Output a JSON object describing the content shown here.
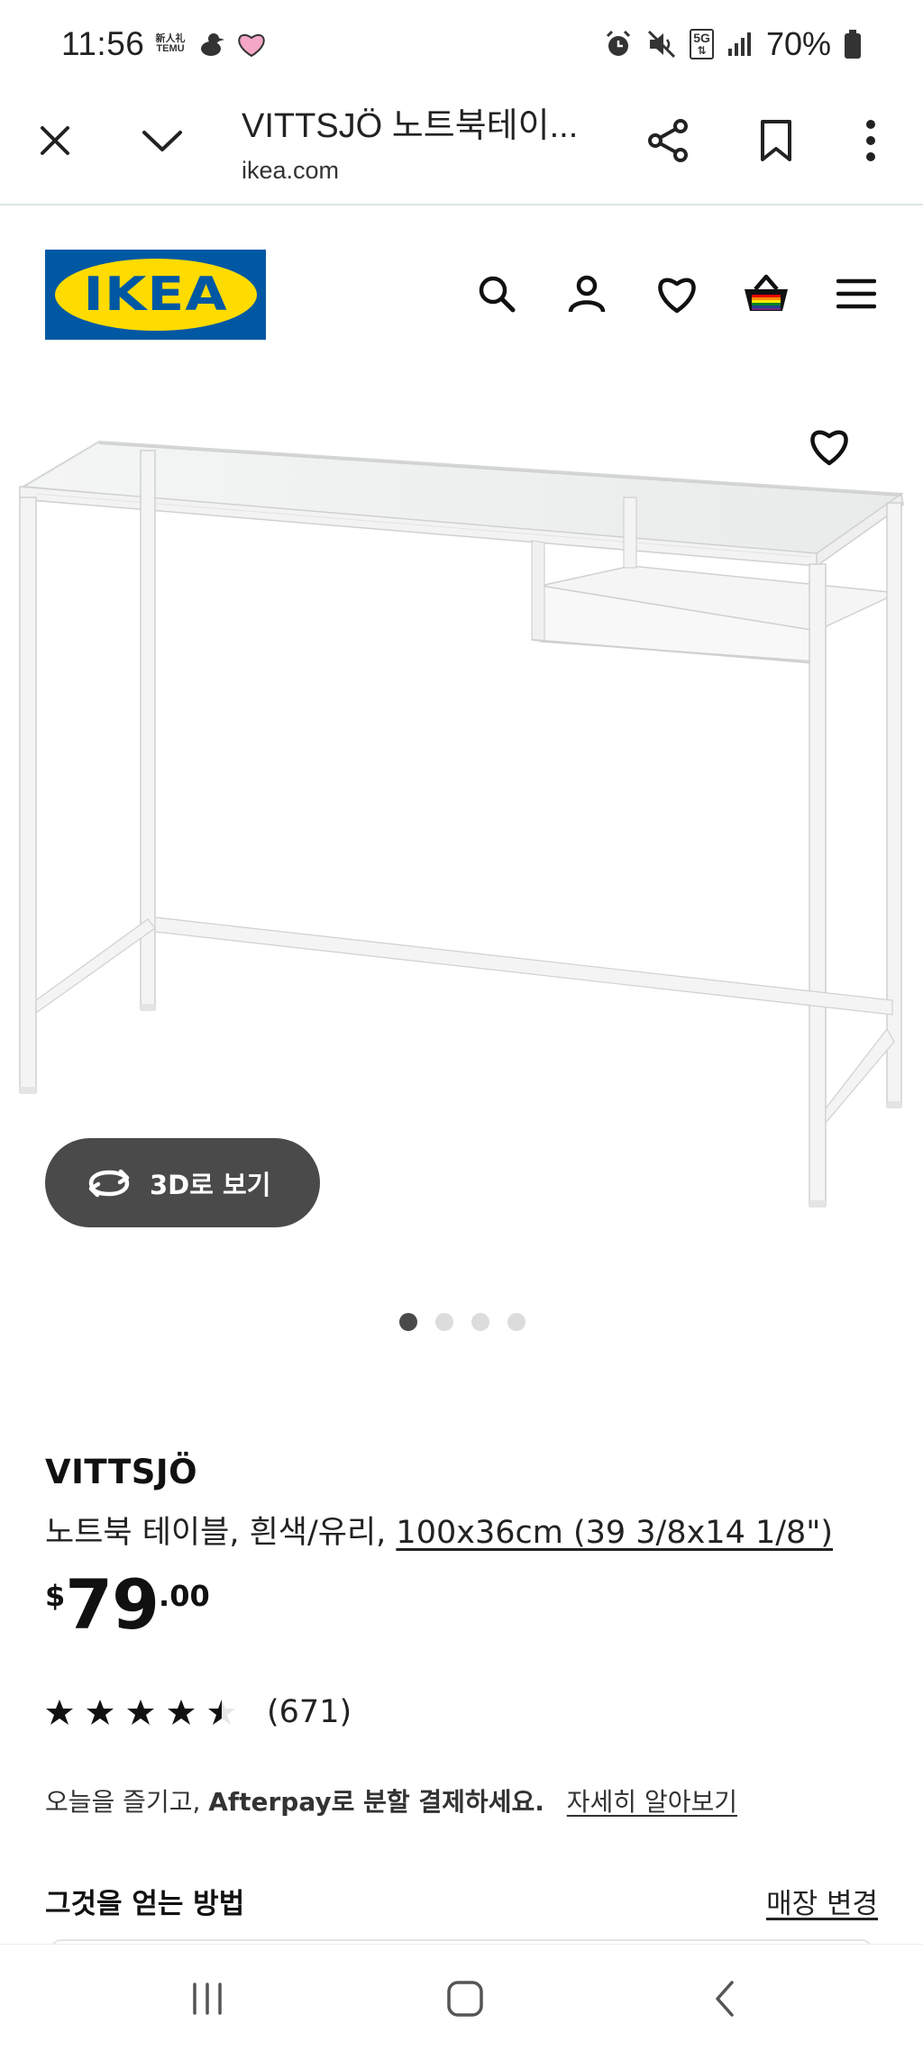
{
  "status_bar": {
    "time": "11:56",
    "temu_label": "新人礼 TEMU",
    "network": "5G",
    "battery": "70%"
  },
  "browser": {
    "title": "VITTSJÖ 노트북테이...",
    "url": "ikea.com"
  },
  "brand": {
    "logo_text": "IKEA",
    "blue": "#0058a3",
    "yellow": "#ffdb00"
  },
  "header_icons": [
    "search-icon",
    "user-icon",
    "heart-icon",
    "basket-icon",
    "menu-icon"
  ],
  "gallery": {
    "view_3d_label": "3D로 보기",
    "dot_count": 4,
    "active_dot": 0
  },
  "product": {
    "name": "VITTSJÖ",
    "description": "노트북 테이블, 흰색/유리, ",
    "dimensions": "100x36cm (39 3/8x14 1/8\")",
    "price_currency": "$",
    "price_int": "79",
    "price_dec": ".00",
    "rating_stars": 4.5,
    "rating_count": "(671)"
  },
  "afterpay": {
    "text_prefix": "오늘을 즐기고, ",
    "text_bold": "Afterpay",
    "text_suffix": "로 분할 결제하세요.",
    "link": "자세히 알아보기"
  },
  "delivery": {
    "heading": "그것을 얻는 방법",
    "change_store": "매장 변경"
  }
}
